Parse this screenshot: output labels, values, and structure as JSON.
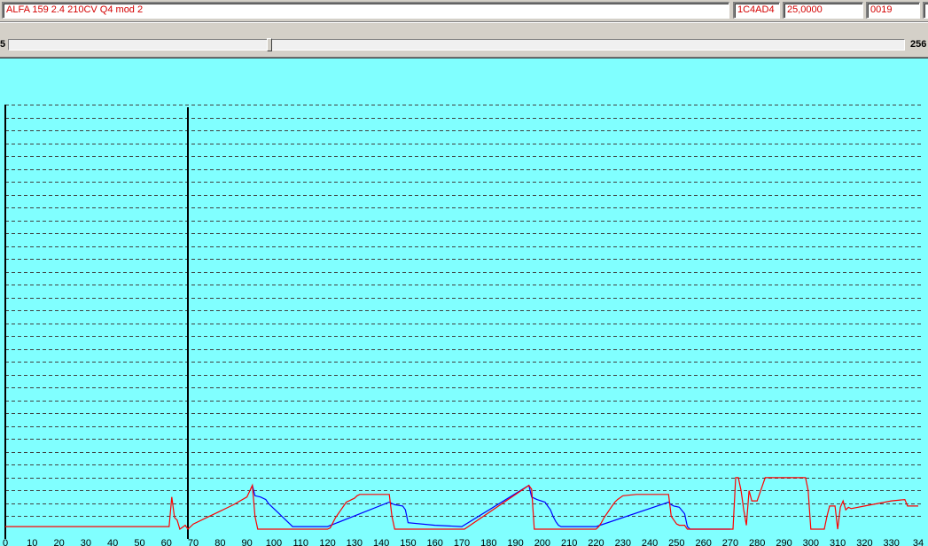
{
  "header": {
    "vehicle_name": "ALFA 159 2.4 210CV Q4  mod 2",
    "ecu_code": "1C4AD4",
    "sample_rate": "25,0000",
    "record_index": "0019"
  },
  "scrollbar": {
    "left_label": "5",
    "max_label": "256",
    "position_fraction": 0.29
  },
  "colors": {
    "plot_background": "#80ffff",
    "series_red": "#ff0000",
    "series_blue": "#0000ff",
    "field_text": "#d40000"
  },
  "chart_data": {
    "type": "line",
    "xlim": [
      0,
      340
    ],
    "ylim": [
      0,
      33
    ],
    "grid": true,
    "x_ticks": [
      0,
      10,
      20,
      30,
      40,
      50,
      60,
      70,
      80,
      90,
      100,
      110,
      120,
      130,
      140,
      150,
      160,
      170,
      180,
      190,
      200,
      210,
      220,
      230,
      240,
      250,
      260,
      270,
      280,
      290,
      300,
      310,
      320,
      330,
      340
    ],
    "tick_labels": [
      "0",
      "10",
      "20",
      "30",
      "40",
      "50",
      "60",
      "70",
      "80",
      "90",
      "100",
      "110",
      "120",
      "130",
      "140",
      "150",
      "160",
      "170",
      "180",
      "190",
      "200",
      "210",
      "220",
      "230",
      "240",
      "250",
      "260",
      "270",
      "280",
      "290",
      "300",
      "310",
      "320",
      "330",
      "34"
    ],
    "cursor_x": 68,
    "series": [
      {
        "color": "#0000ff",
        "x": [
          92,
          93,
          95,
          97,
          98,
          99,
          100,
          101,
          102,
          103,
          104,
          105,
          106,
          107,
          108,
          110,
          115,
          120,
          143,
          144,
          145,
          148,
          149,
          150,
          160,
          170,
          195,
          196,
          198,
          201,
          202,
          203,
          204,
          205,
          206,
          207,
          208,
          210,
          215,
          220,
          247,
          248,
          249,
          251,
          253,
          254,
          255,
          260,
          270
        ],
        "y": [
          3.4,
          2.6,
          2.5,
          2.3,
          2.0,
          1.8,
          1.6,
          1.4,
          1.2,
          1.0,
          0.8,
          0.6,
          0.4,
          0.2,
          0.2,
          0.2,
          0.2,
          0.2,
          2.1,
          2.0,
          1.9,
          1.8,
          1.5,
          0.5,
          0.3,
          0.2,
          3.4,
          2.5,
          2.3,
          2.1,
          1.8,
          1.5,
          1.0,
          0.6,
          0.3,
          0.2,
          0.2,
          0.2,
          0.2,
          0.2,
          2.1,
          1.9,
          1.8,
          1.7,
          1.2,
          0.2,
          0.0,
          0.0,
          0.0
        ]
      },
      {
        "color": "#ff0000",
        "x": [
          0,
          30,
          61,
          62,
          63,
          64,
          65,
          67,
          68,
          70,
          75,
          80,
          85,
          90,
          92,
          93,
          94,
          95,
          100,
          110,
          120,
          121,
          122,
          123,
          124,
          125,
          126,
          127,
          128,
          129,
          130,
          131,
          132,
          133,
          135,
          140,
          143,
          144,
          145,
          150,
          160,
          170,
          171,
          195,
          196,
          197,
          198,
          200,
          210,
          220,
          221,
          222,
          223,
          224,
          225,
          226,
          227,
          228,
          230,
          235,
          240,
          245,
          247,
          248,
          250,
          251,
          253,
          254,
          255,
          260,
          270,
          271,
          272,
          273,
          274,
          275,
          276,
          277,
          278,
          280,
          282,
          283,
          284,
          285,
          286,
          290,
          295,
          298,
          299,
          300,
          305,
          306,
          307,
          308,
          309,
          310,
          311,
          312,
          313,
          314,
          315,
          320,
          325,
          330,
          335,
          336,
          340
        ],
        "y": [
          0.2,
          0.2,
          0.2,
          2.5,
          0.9,
          0.7,
          0.0,
          0.3,
          0.0,
          0.4,
          0.9,
          1.4,
          1.9,
          2.5,
          3.4,
          1.0,
          0.0,
          0.0,
          0.0,
          0.0,
          0.0,
          0.1,
          0.5,
          0.9,
          1.2,
          1.5,
          1.8,
          2.1,
          2.2,
          2.3,
          2.4,
          2.6,
          2.7,
          2.7,
          2.7,
          2.7,
          2.7,
          1.0,
          0.0,
          0.0,
          0.0,
          0.0,
          0.0,
          3.4,
          3.1,
          0.0,
          0.0,
          0.0,
          0.0,
          0.0,
          0.2,
          0.5,
          0.9,
          1.2,
          1.5,
          1.8,
          2.1,
          2.3,
          2.6,
          2.7,
          2.7,
          2.7,
          2.7,
          1.0,
          0.4,
          0.3,
          0.3,
          0.0,
          0.0,
          0.0,
          0.0,
          0.0,
          4.0,
          4.0,
          3.0,
          1.5,
          0.3,
          3.0,
          2.2,
          2.2,
          3.4,
          4.0,
          4.0,
          4.0,
          4.0,
          4.0,
          4.0,
          4.0,
          3.0,
          0.0,
          0.0,
          1.0,
          1.8,
          1.8,
          1.8,
          0.0,
          1.7,
          2.2,
          1.5,
          1.7,
          1.6,
          1.8,
          2.0,
          2.2,
          2.3,
          1.8,
          1.8
        ]
      }
    ]
  }
}
